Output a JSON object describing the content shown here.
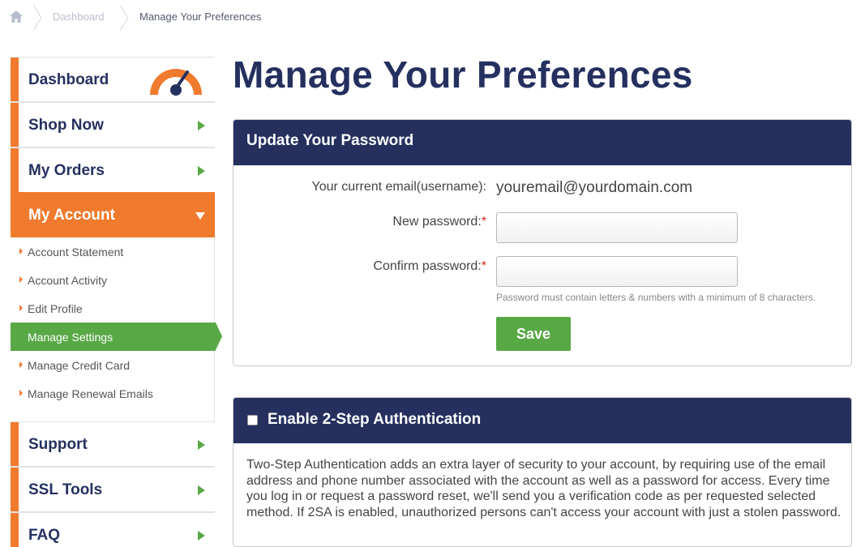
{
  "breadcrumb": {
    "items": [
      "Dashboard",
      "Manage Your Preferences"
    ]
  },
  "sidebar": {
    "main_items": [
      {
        "label": "Dashboard"
      },
      {
        "label": "Shop Now"
      },
      {
        "label": "My Orders"
      },
      {
        "label": "My Account"
      },
      {
        "label": "Support"
      },
      {
        "label": "SSL Tools"
      },
      {
        "label": "FAQ"
      }
    ],
    "sub_items": [
      {
        "label": "Account Statement"
      },
      {
        "label": "Account Activity"
      },
      {
        "label": "Edit Profile"
      },
      {
        "label": "Manage Settings"
      },
      {
        "label": "Manage Credit Card"
      },
      {
        "label": "Manage Renewal Emails"
      }
    ]
  },
  "page": {
    "title": "Manage Your Preferences"
  },
  "password_panel": {
    "title": "Update Your Password",
    "email_label": "Your current email(username):",
    "email_value": "youremail@yourdomain.com",
    "new_password_label": "New password:",
    "confirm_password_label": "Confirm password:",
    "required_mark": "*",
    "new_password_value": "",
    "confirm_password_value": "",
    "hint": "Password must contain letters & numbers with a minimum of 8 characters.",
    "save_label": "Save"
  },
  "tsa_panel": {
    "title": "Enable 2-Step Authentication",
    "checked": false,
    "body": "Two-Step Authentication adds an extra layer of security to your account, by requiring use of the email address and phone number associated with the account as well as a password for access. Every time you log in or request a password reset, we'll send you a verification code as per requested selected method. If 2SA is enabled, unauthorized persons can't access your account with just a stolen password."
  },
  "colors": {
    "navy": "#25305f",
    "orange": "#f07a2d",
    "green": "#58a846",
    "required": "#d2281f"
  },
  "icons": [
    "home-icon",
    "gauge-icon",
    "chevron-right-icon",
    "chevron-down-icon",
    "bullet-triangle-icon"
  ]
}
